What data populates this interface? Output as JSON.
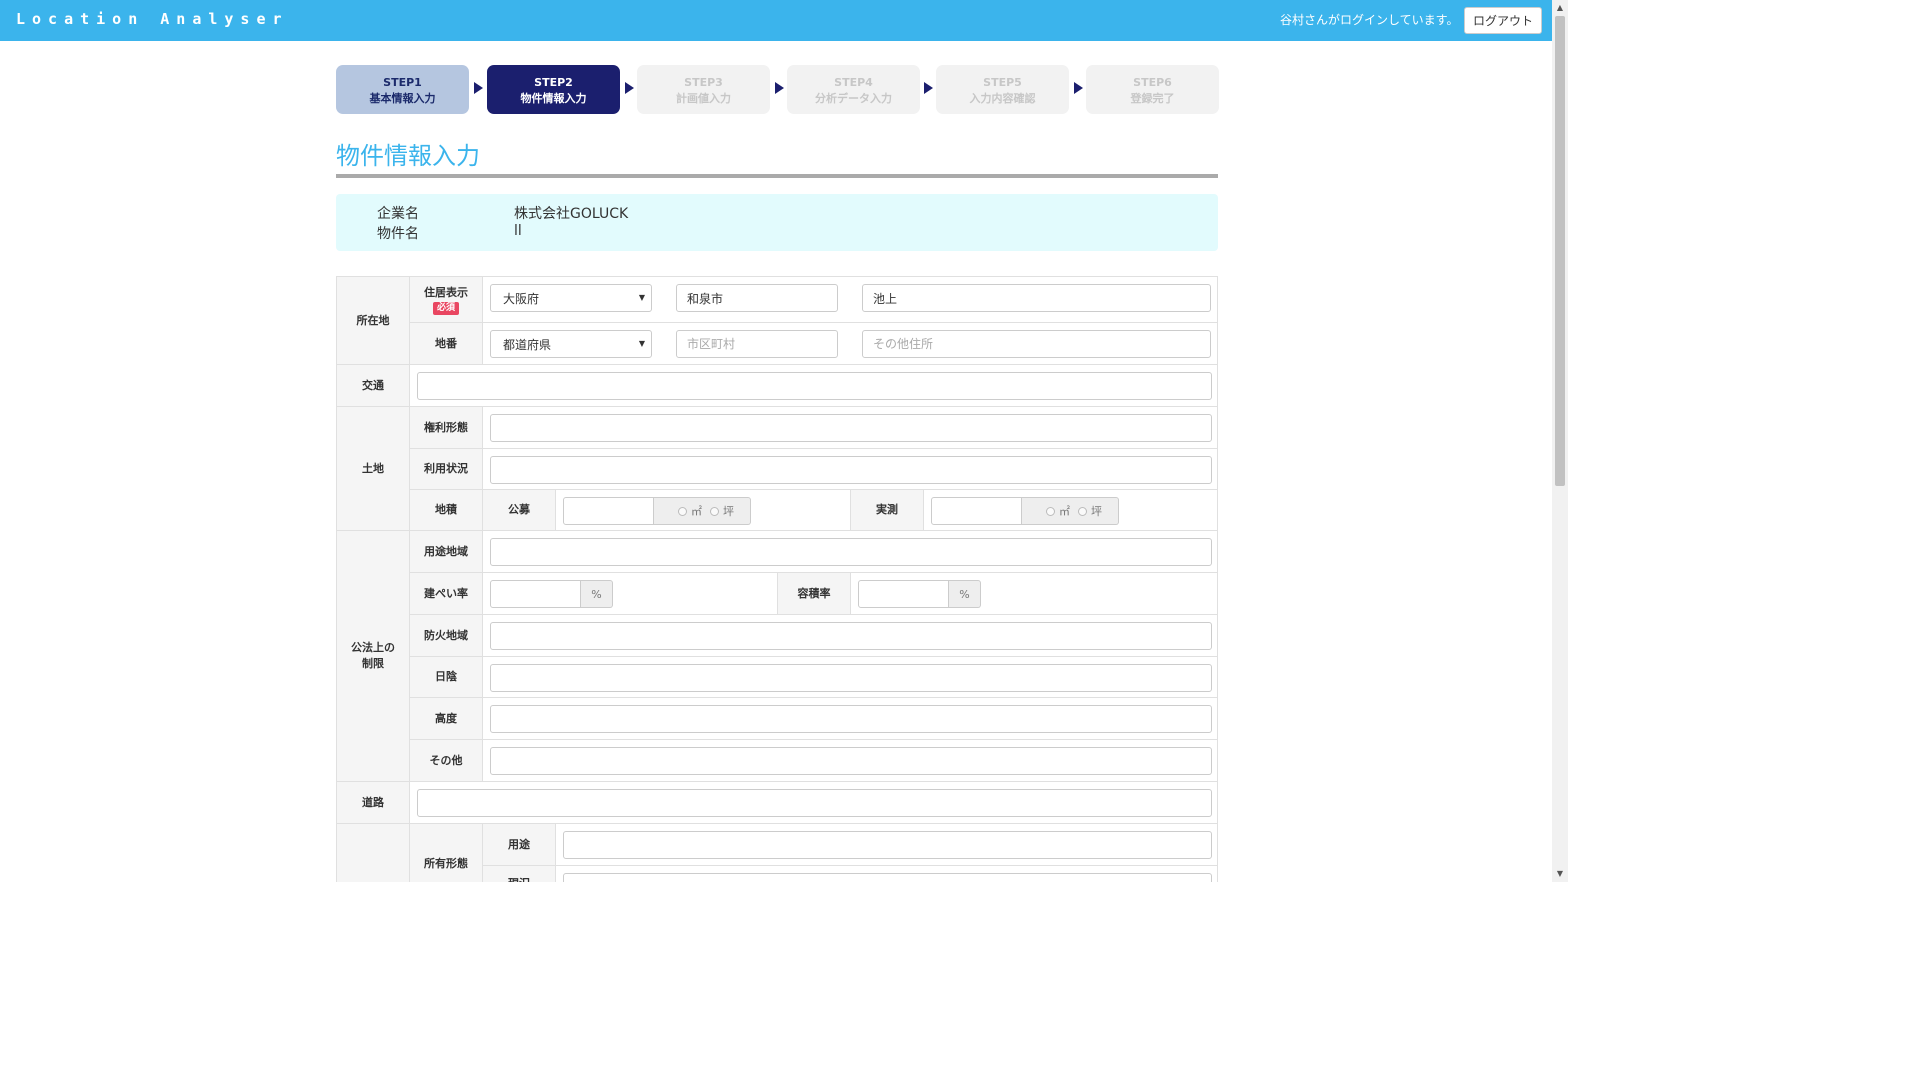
{
  "header": {
    "brand": "Location Analyser",
    "login_message": "谷村さんがログインしています。",
    "logout_label": "ログアウト"
  },
  "steps": [
    {
      "num": "STEP1",
      "label": "基本情報入力",
      "state": "done"
    },
    {
      "num": "STEP2",
      "label": "物件情報入力",
      "state": "active"
    },
    {
      "num": "STEP3",
      "label": "計画値入力",
      "state": "todo"
    },
    {
      "num": "STEP4",
      "label": "分析データ入力",
      "state": "todo"
    },
    {
      "num": "STEP5",
      "label": "入力内容確認",
      "state": "todo"
    },
    {
      "num": "STEP6",
      "label": "登録完了",
      "state": "todo"
    }
  ],
  "page_title": "物件情報入力",
  "info": {
    "company_label": "企業名",
    "company_value": "株式会社GOLUCK",
    "property_label": "物件名",
    "property_value": "ll"
  },
  "form": {
    "location": {
      "label": "所在地",
      "address_label": "住居表示",
      "required_badge": "必須",
      "address_prefecture": "大阪府",
      "address_city": "和泉市",
      "address_other": "池上",
      "lot_label": "地番",
      "lot_prefecture": "都道府県",
      "lot_city_placeholder": "市区町村",
      "lot_other_placeholder": "その他住所"
    },
    "transport": {
      "label": "交通",
      "value": ""
    },
    "land": {
      "label": "土地",
      "rights_label": "権利形態",
      "usage_label": "利用状況",
      "area_label": "地積",
      "official_label": "公募",
      "measured_label": "実測",
      "unit_sqm": "㎡",
      "unit_tsubo": "坪"
    },
    "legal": {
      "label": "公法上の制限",
      "zoning_label": "用途地域",
      "coverage_label": "建ぺい率",
      "far_label": "容積率",
      "percent": "%",
      "fire_label": "防火地域",
      "shade_label": "日陰",
      "height_label": "高度",
      "other_label": "その他"
    },
    "road": {
      "label": "道路"
    },
    "ownership": {
      "label": "所有形態",
      "use_label": "用途",
      "status_label": "現況"
    }
  }
}
